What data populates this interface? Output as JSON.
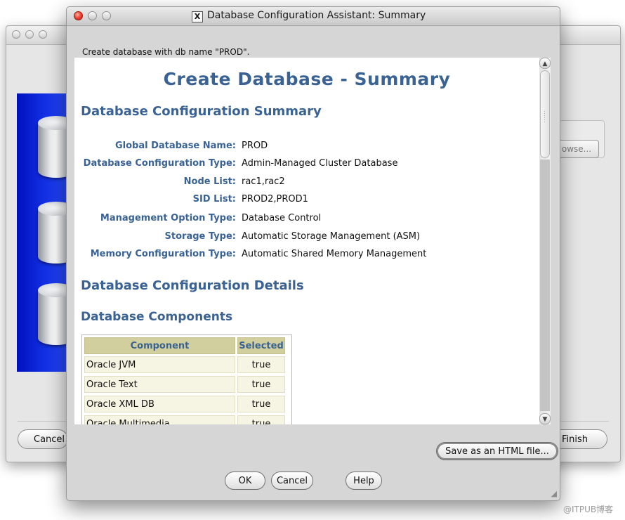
{
  "background_window": {
    "browse_label": "owse...",
    "cancel_label": "Cancel",
    "finish_label": "Finish"
  },
  "dialog": {
    "title": "Database Configuration Assistant: Summary",
    "message": "Create database with db name \"PROD\".",
    "summary": {
      "title": "Create Database - Summary",
      "config_summary_heading": "Database Configuration Summary",
      "fields": [
        {
          "label": "Global Database Name:",
          "value": "PROD"
        },
        {
          "label": "Database Configuration Type:",
          "value": "Admin-Managed Cluster Database"
        },
        {
          "label": "Node List:",
          "value": "rac1,rac2"
        },
        {
          "label": "SID List:",
          "value": "PROD2,PROD1"
        },
        {
          "label": "Management Option Type:",
          "value": "Database Control"
        },
        {
          "label": "Storage Type:",
          "value": "Automatic Storage Management (ASM)"
        },
        {
          "label": "Memory Configuration Type:",
          "value": "Automatic Shared Memory Management"
        }
      ],
      "config_details_heading": "Database Configuration Details",
      "components_heading": "Database Components",
      "components_table": {
        "headers": [
          "Component",
          "Selected"
        ],
        "rows": [
          [
            "Oracle JVM",
            "true"
          ],
          [
            "Oracle Text",
            "true"
          ],
          [
            "Oracle XML DB",
            "true"
          ],
          [
            "Oracle Multimedia",
            "true"
          ]
        ]
      }
    },
    "buttons": {
      "save_html": "Save as an HTML file...",
      "ok": "OK",
      "cancel": "Cancel",
      "help": "Help"
    }
  },
  "watermark": "@ITPUB博客"
}
